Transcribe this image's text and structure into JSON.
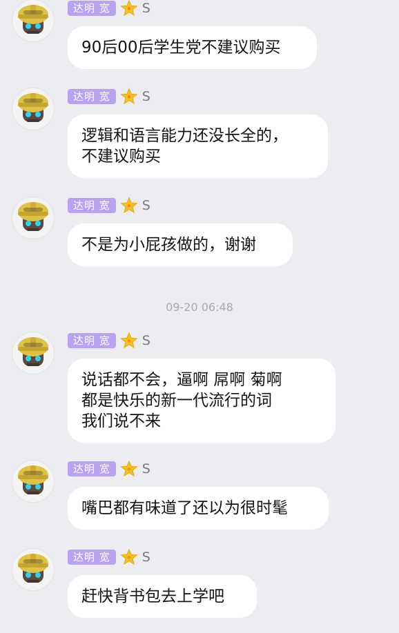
{
  "timestamp": "09-20 06:48",
  "icons": {
    "avatar": "hard-hat-robot-avatar",
    "level": "star-icon"
  },
  "colors": {
    "background": "#ececf1",
    "name_badge": "#b9a3f1",
    "bubble": "#ffffff",
    "star": "#f4c21a"
  },
  "messages": [
    {
      "user": "达明 宽",
      "level": "S",
      "text": "90后00后学生党不建议购买"
    },
    {
      "user": "达明 宽",
      "level": "S",
      "text": "逻辑和语言能力还没长全的，\n不建议购买"
    },
    {
      "user": "达明 宽",
      "level": "S",
      "text": "不是为小屁孩做的，谢谢"
    },
    {
      "user": "达明 宽",
      "level": "S",
      "text": "说话都不会，逼啊  屌啊  菊啊\n  都是快乐的新一代流行的词\n我们说不来"
    },
    {
      "user": "达明 宽",
      "level": "S",
      "text": "嘴巴都有味道了还以为很时髦"
    },
    {
      "user": "达明 宽",
      "level": "S",
      "text": "赶快背书包去上学吧"
    }
  ]
}
